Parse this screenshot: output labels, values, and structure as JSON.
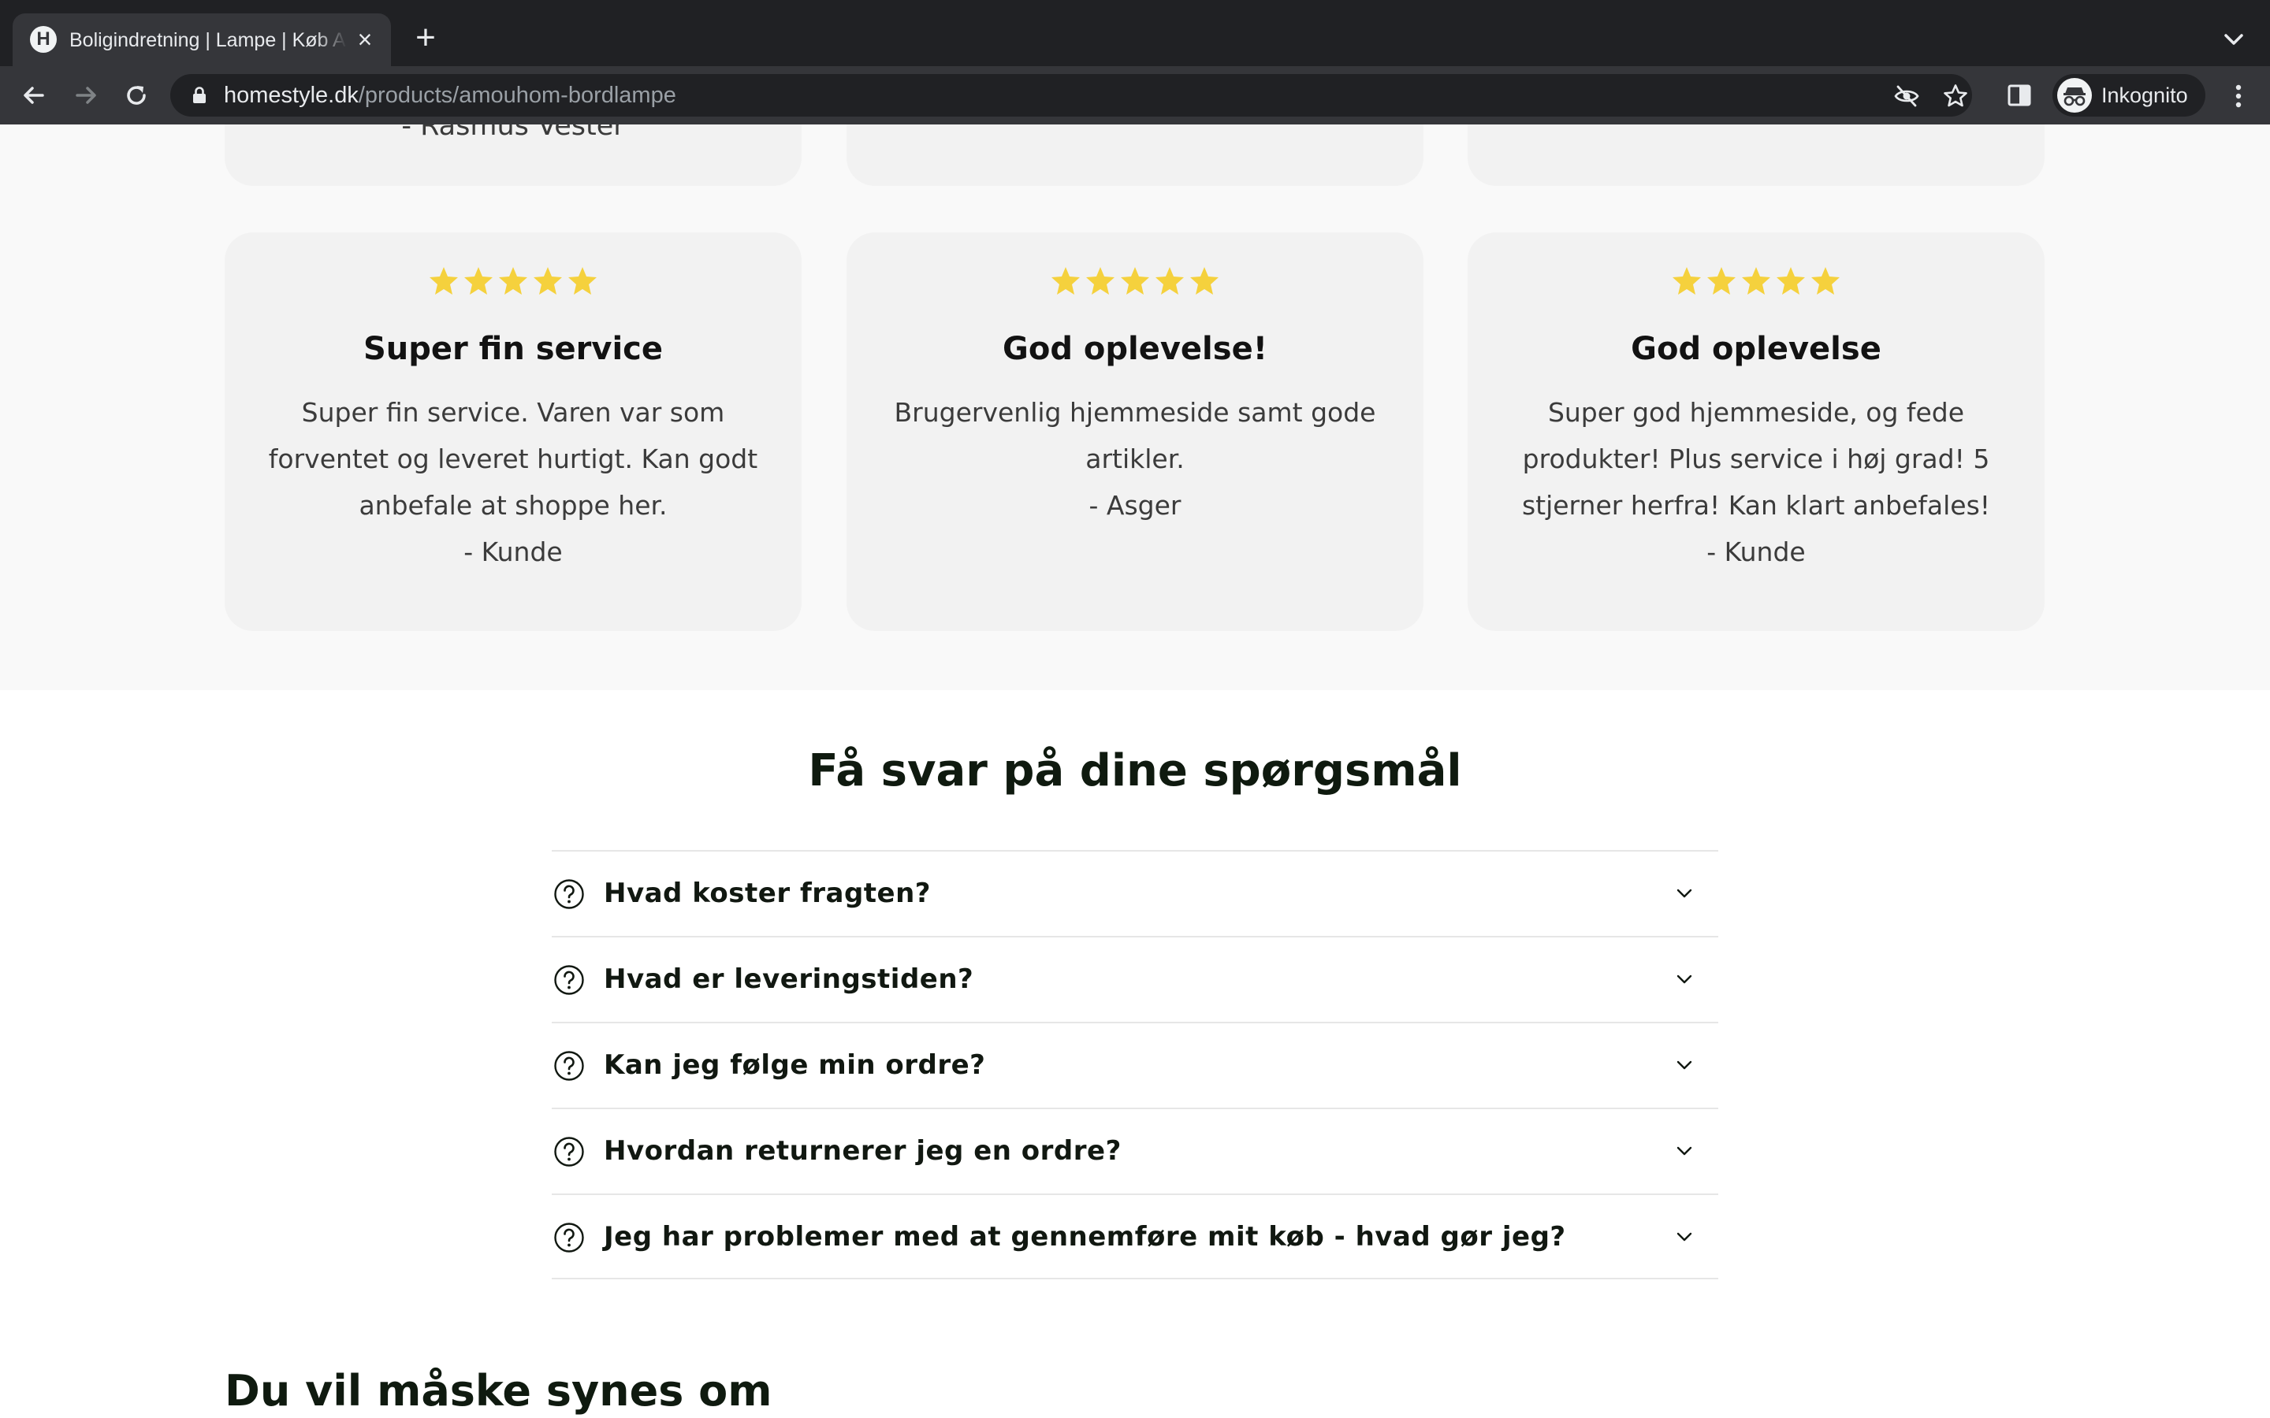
{
  "browser": {
    "tab_title": "Boligindretning | Lampe | Køb A",
    "favicon_letter": "H",
    "url_host": "homestyle.dk",
    "url_path": "/products/amouhom-bordlampe",
    "profile_label": "Inkognito"
  },
  "reviews": {
    "partial_author": "- Rasmus Vester",
    "star_color": "#f5d13d",
    "cards": [
      {
        "rating": 5,
        "title": "Super fin service",
        "text": "Super fin service. Varen var som forventet og leveret hurtigt. Kan godt anbefale at shoppe her.",
        "author": "- Kunde"
      },
      {
        "rating": 5,
        "title": "God oplevelse!",
        "text": "Brugervenlig hjemmeside samt gode artikler.",
        "author": "- Asger"
      },
      {
        "rating": 5,
        "title": "God oplevelse",
        "text": "Super god hjemmeside, og fede produkter! Plus service i høj grad! 5 stjerner herfra! Kan klart anbefales!",
        "author": "- Kunde"
      }
    ]
  },
  "faq": {
    "heading": "Få svar på dine spørgsmål",
    "items": [
      "Hvad koster fragten?",
      "Hvad er leveringstiden?",
      "Kan jeg følge min ordre?",
      "Hvordan returnerer jeg en ordre?",
      "Jeg har problemer med at gennemføre mit køb - hvad gør jeg?"
    ]
  },
  "related": {
    "heading": "Du vil måske synes om"
  }
}
